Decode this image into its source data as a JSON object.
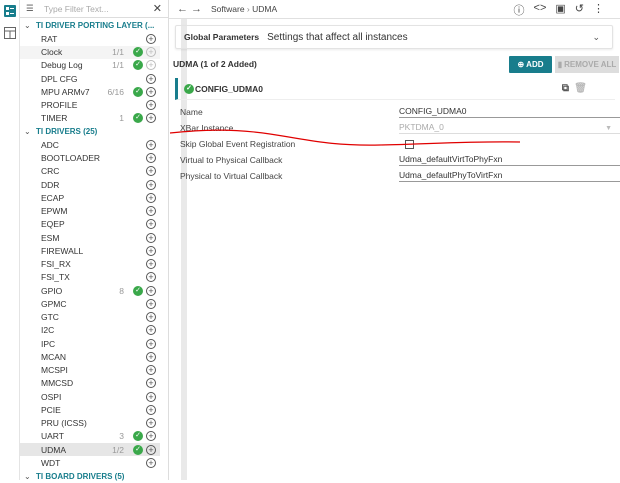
{
  "filter": {
    "placeholder": "Type Filter Text..."
  },
  "tree": [
    {
      "type": "hdr",
      "label": "TI DRIVER PORTING LAYER (..."
    },
    {
      "label": "RAT"
    },
    {
      "label": "Clock",
      "count": "1/1",
      "ok": true,
      "dim": true,
      "hov": true
    },
    {
      "label": "Debug Log",
      "count": "1/1",
      "ok": true,
      "dim": true
    },
    {
      "label": "DPL CFG"
    },
    {
      "label": "MPU ARMv7",
      "count": "6/16",
      "ok": true
    },
    {
      "label": "PROFILE"
    },
    {
      "label": "TIMER",
      "count": "1",
      "ok": true
    },
    {
      "type": "hdr",
      "label": "TI DRIVERS (25)"
    },
    {
      "label": "ADC"
    },
    {
      "label": "BOOTLOADER"
    },
    {
      "label": "CRC"
    },
    {
      "label": "DDR"
    },
    {
      "label": "ECAP"
    },
    {
      "label": "EPWM"
    },
    {
      "label": "EQEP"
    },
    {
      "label": "ESM"
    },
    {
      "label": "FIREWALL"
    },
    {
      "label": "FSI_RX"
    },
    {
      "label": "FSI_TX"
    },
    {
      "label": "GPIO",
      "count": "8",
      "ok": true
    },
    {
      "label": "GPMC"
    },
    {
      "label": "GTC"
    },
    {
      "label": "I2C"
    },
    {
      "label": "IPC"
    },
    {
      "label": "MCAN"
    },
    {
      "label": "MCSPI"
    },
    {
      "label": "MMCSD"
    },
    {
      "label": "OSPI"
    },
    {
      "label": "PCIE"
    },
    {
      "label": "PRU (ICSS)"
    },
    {
      "label": "UART",
      "count": "3",
      "ok": true
    },
    {
      "label": "UDMA",
      "count": "1/2",
      "ok": true,
      "sel": true
    },
    {
      "label": "WDT"
    },
    {
      "type": "hdr",
      "label": "TI BOARD DRIVERS (5)"
    }
  ],
  "breadcrumb": {
    "root": "Software",
    "sep": "›",
    "current": "UDMA"
  },
  "global": {
    "title": "Global Parameters",
    "desc": "Settings that affect all instances"
  },
  "instances": {
    "title": "UDMA (1 of 2 Added)",
    "add": "ADD",
    "remove_all": "REMOVE ALL",
    "name": "CONFIG_UDMA0"
  },
  "fields": [
    {
      "label": "Name",
      "value": "CONFIG_UDMA0"
    },
    {
      "label": "XBar Instance",
      "value": "PKTDMA_0",
      "disabled": true
    },
    {
      "label": "Skip Global Event Registration",
      "checkbox": true,
      "checked": false
    },
    {
      "label": "Virtual to Physical Callback",
      "value": "Udma_defaultVirtToPhyFxn"
    },
    {
      "label": "Physical to Virtual Callback",
      "value": "Udma_defaultPhyToVirtFxn"
    }
  ],
  "colors": {
    "accent": "#187d8c",
    "ok": "#3aa84a",
    "annotation": "#e00000"
  }
}
